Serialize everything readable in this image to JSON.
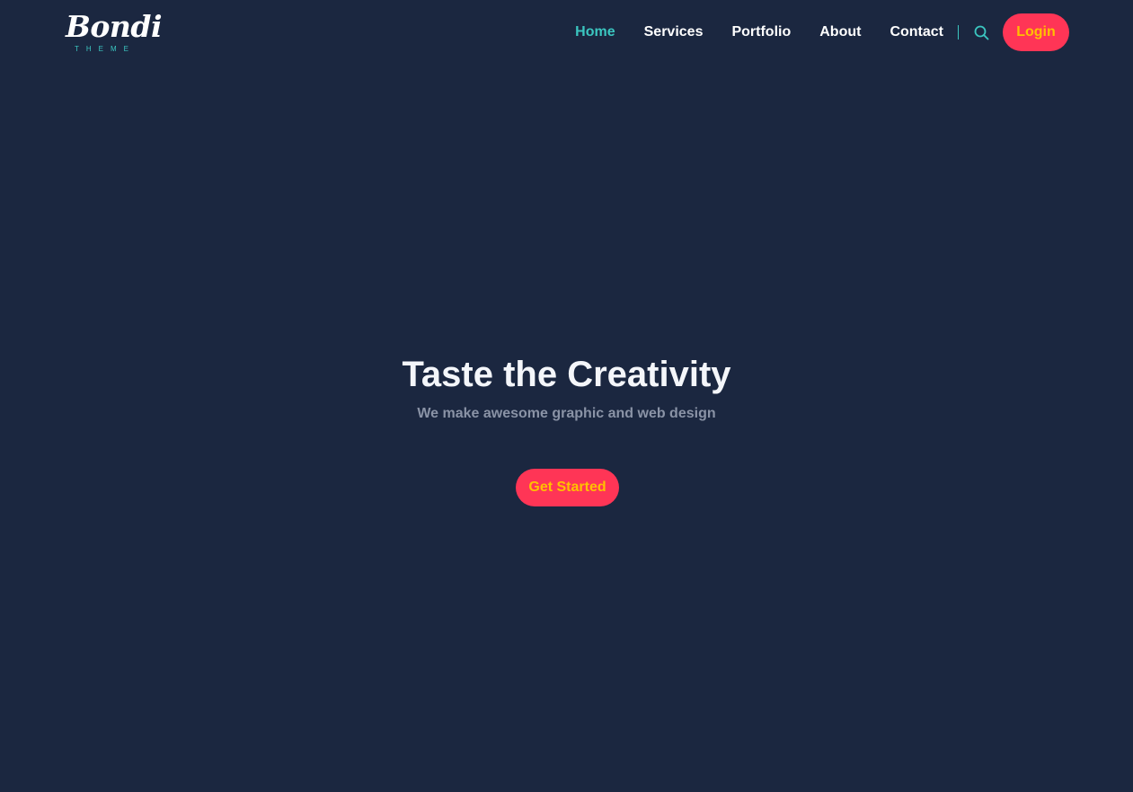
{
  "header": {
    "logo": {
      "word": "Bondi",
      "subtitle": "THEME"
    },
    "nav": {
      "items": [
        {
          "label": "Home",
          "active": true
        },
        {
          "label": "Services",
          "active": false
        },
        {
          "label": "Portfolio",
          "active": false
        },
        {
          "label": "About",
          "active": false
        },
        {
          "label": "Contact",
          "active": false
        }
      ],
      "search_icon": "search-icon",
      "login_label": "Login"
    }
  },
  "hero": {
    "title": "Taste the Creativity",
    "subtitle": "We make awesome graphic and web design",
    "cta_label": "Get Started"
  },
  "colors": {
    "background": "#1b2740",
    "accent": "#3bc6c0",
    "button_bg": "#ff3556",
    "button_text": "#ffc000",
    "subtitle_text": "#8a93a6"
  }
}
